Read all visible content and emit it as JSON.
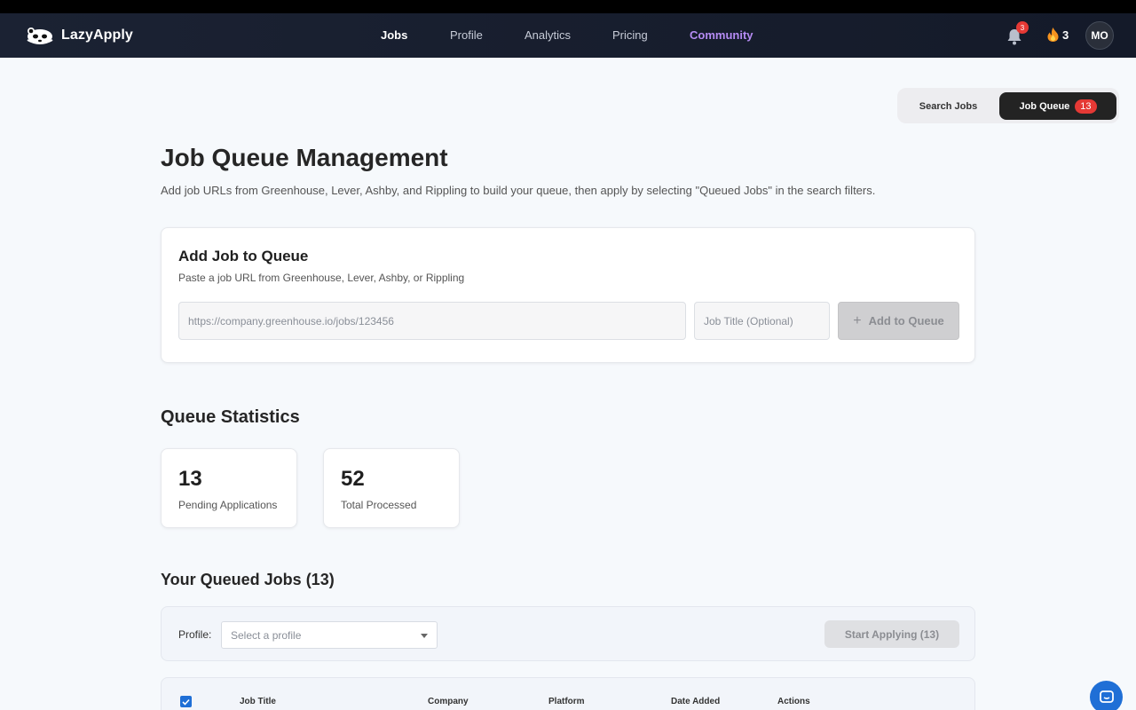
{
  "nav": {
    "brand": "LazyApply",
    "links": [
      "Jobs",
      "Profile",
      "Analytics",
      "Pricing",
      "Community"
    ],
    "notification_count": "3",
    "streak_count": "3",
    "avatar_initials": "MO"
  },
  "tabs": {
    "search_label": "Search Jobs",
    "queue_label": "Job Queue",
    "queue_count": "13"
  },
  "header": {
    "title": "Job Queue Management",
    "subtitle": "Add job URLs from Greenhouse, Lever, Ashby, and Rippling to build your queue, then apply by selecting \"Queued Jobs\" in the search filters."
  },
  "add_job": {
    "title": "Add Job to Queue",
    "subtitle": "Paste a job URL from Greenhouse, Lever, Ashby, or Rippling",
    "url_placeholder": "https://company.greenhouse.io/jobs/123456",
    "title_placeholder": "Job Title (Optional)",
    "button_label": "Add to Queue"
  },
  "stats": {
    "title": "Queue Statistics",
    "items": [
      {
        "value": "13",
        "label": "Pending Applications"
      },
      {
        "value": "52",
        "label": "Total Processed"
      }
    ]
  },
  "queue": {
    "title": "Your Queued Jobs (13)",
    "profile_label": "Profile:",
    "profile_placeholder": "Select a profile",
    "start_button": "Start Applying (13)",
    "columns": [
      "Job Title",
      "Company",
      "Platform",
      "Date Added",
      "Actions"
    ]
  },
  "colors": {
    "nav_bg": "#1b2233",
    "community": "#b68cf5",
    "badge": "#e53935",
    "accent_blue": "#1f6fd6"
  },
  "icons": [
    "panda-logo-icon",
    "bell-icon",
    "flame-icon",
    "plus-icon",
    "chevron-down-icon",
    "checkbox-checked-icon",
    "chat-icon"
  ]
}
